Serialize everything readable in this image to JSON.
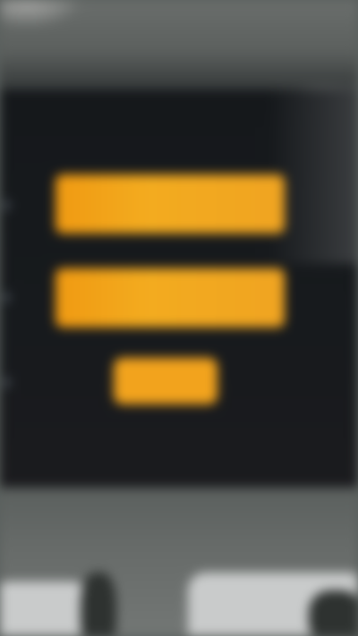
{
  "login_form": {
    "username_placeholder": "",
    "password_placeholder": "",
    "submit_label": "",
    "secondary_label": ""
  },
  "colors": {
    "field_fill": "#f2a31d",
    "screen_background": "#16191c",
    "room_background": "#5f6462"
  },
  "icons": {
    "left_column": [
      "field-icon",
      "field-icon",
      "field-icon"
    ]
  }
}
